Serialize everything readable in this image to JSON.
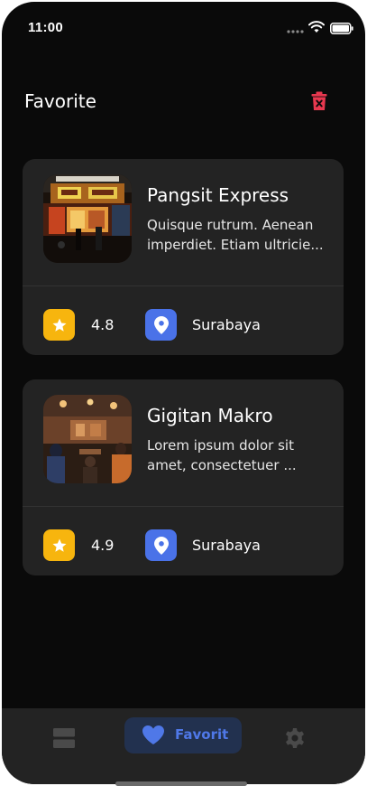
{
  "status_bar": {
    "time": "11:00"
  },
  "header": {
    "title": "Favorite",
    "delete_icon": "trash-icon",
    "delete_color": "#e8384f"
  },
  "favorites": [
    {
      "name": "Pangsit Express",
      "description_line1": "Quisque rutrum. Aenean",
      "description_line2": "imperdiet. Etiam ultricie...",
      "rating": "4.8",
      "city": "Surabaya",
      "thumbnail": "restaurant-storefront-night-photo"
    },
    {
      "name": "Gigitan Makro",
      "description_line1": "Lorem ipsum dolor sit",
      "description_line2": "amet, consectetuer ...",
      "rating": "4.9",
      "city": "Surabaya",
      "thumbnail": "restaurant-interior-crowd-photo"
    }
  ],
  "bottom_nav": {
    "items": [
      {
        "icon": "list-icon",
        "label": "",
        "active": false
      },
      {
        "icon": "heart-icon",
        "label": "Favorit",
        "active": true
      },
      {
        "icon": "gear-icon",
        "label": "",
        "active": false
      }
    ]
  },
  "colors": {
    "background": "#0a0a0a",
    "card": "#232323",
    "star_badge": "#f7b50e",
    "pin_badge": "#4a72e8",
    "accent": "#4f78e8"
  }
}
